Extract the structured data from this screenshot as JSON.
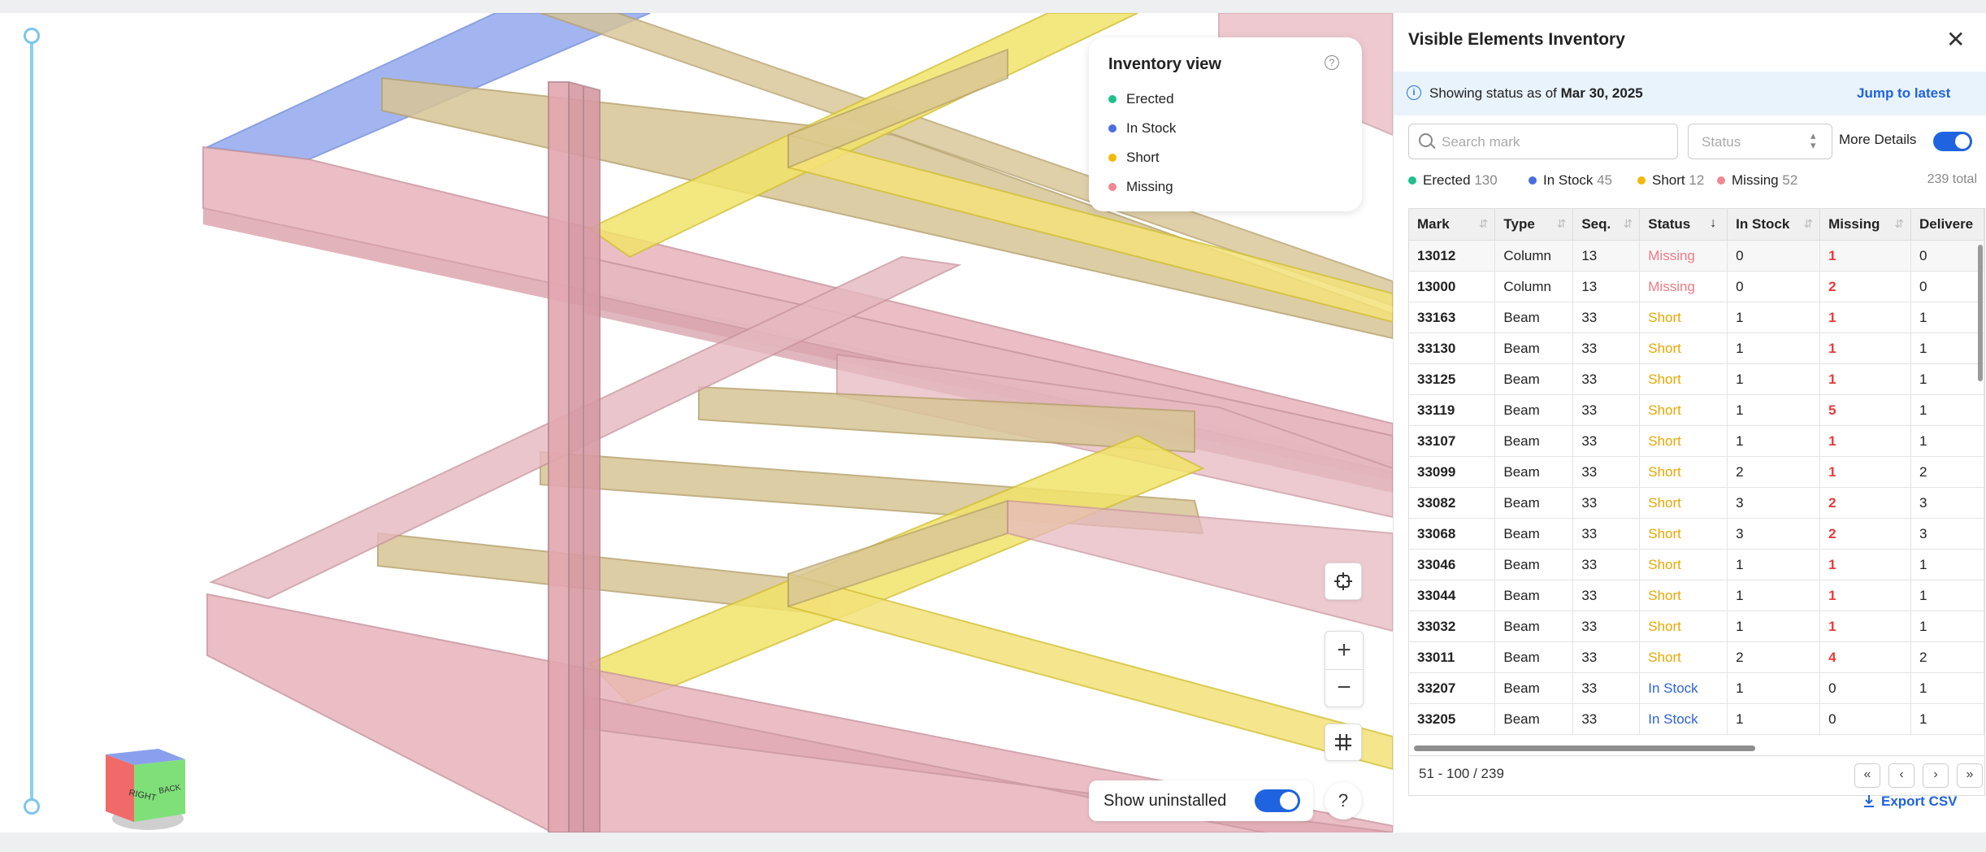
{
  "legend": {
    "title": "Inventory view",
    "items": [
      {
        "label": "Erected",
        "color": "#1fbf8f"
      },
      {
        "label": "In Stock",
        "color": "#4a6ee0"
      },
      {
        "label": "Short",
        "color": "#f2b90c"
      },
      {
        "label": "Missing",
        "color": "#f08792"
      }
    ]
  },
  "viewer": {
    "show_uninstalled_label": "Show uninstalled",
    "show_uninstalled_on": true,
    "help_label": "?",
    "cube_right_label": "RIGHT",
    "cube_back_label": "BACK"
  },
  "panel": {
    "title": "Visible Elements Inventory",
    "close": "✕",
    "info_prefix": "Showing status as of",
    "info_date": "Mar 30, 2025",
    "jump_link": "Jump to latest",
    "search_placeholder": "Search mark",
    "status_placeholder": "Status",
    "more_details_label": "More Details",
    "more_details_on": true,
    "counts": [
      {
        "label": "Erected",
        "value": "130",
        "color": "#1fbf8f"
      },
      {
        "label": "In Stock",
        "value": "45",
        "color": "#4a6ee0"
      },
      {
        "label": "Short",
        "value": "12",
        "color": "#f2b90c"
      },
      {
        "label": "Missing",
        "value": "52",
        "color": "#f08792"
      }
    ],
    "total": "239 total",
    "columns": [
      "Mark",
      "Type",
      "Seq.",
      "Status",
      "In Stock",
      "Missing",
      "Delivere"
    ],
    "rows": [
      [
        "13012",
        "Column",
        "13",
        "Missing",
        "0",
        "1",
        "0"
      ],
      [
        "13000",
        "Column",
        "13",
        "Missing",
        "0",
        "2",
        "0"
      ],
      [
        "33163",
        "Beam",
        "33",
        "Short",
        "1",
        "1",
        "1"
      ],
      [
        "33130",
        "Beam",
        "33",
        "Short",
        "1",
        "1",
        "1"
      ],
      [
        "33125",
        "Beam",
        "33",
        "Short",
        "1",
        "1",
        "1"
      ],
      [
        "33119",
        "Beam",
        "33",
        "Short",
        "1",
        "5",
        "1"
      ],
      [
        "33107",
        "Beam",
        "33",
        "Short",
        "1",
        "1",
        "1"
      ],
      [
        "33099",
        "Beam",
        "33",
        "Short",
        "2",
        "1",
        "2"
      ],
      [
        "33082",
        "Beam",
        "33",
        "Short",
        "3",
        "2",
        "3"
      ],
      [
        "33068",
        "Beam",
        "33",
        "Short",
        "3",
        "2",
        "3"
      ],
      [
        "33046",
        "Beam",
        "33",
        "Short",
        "1",
        "1",
        "1"
      ],
      [
        "33044",
        "Beam",
        "33",
        "Short",
        "1",
        "1",
        "1"
      ],
      [
        "33032",
        "Beam",
        "33",
        "Short",
        "1",
        "1",
        "1"
      ],
      [
        "33011",
        "Beam",
        "33",
        "Short",
        "2",
        "4",
        "2"
      ],
      [
        "33207",
        "Beam",
        "33",
        "In Stock",
        "1",
        "0",
        "1"
      ],
      [
        "33205",
        "Beam",
        "33",
        "In Stock",
        "1",
        "0",
        "1"
      ]
    ],
    "pager_text": "51 - 100 / 239",
    "pager_buttons": [
      "«",
      "‹",
      "›",
      "»"
    ],
    "export_label": "Export CSV"
  }
}
